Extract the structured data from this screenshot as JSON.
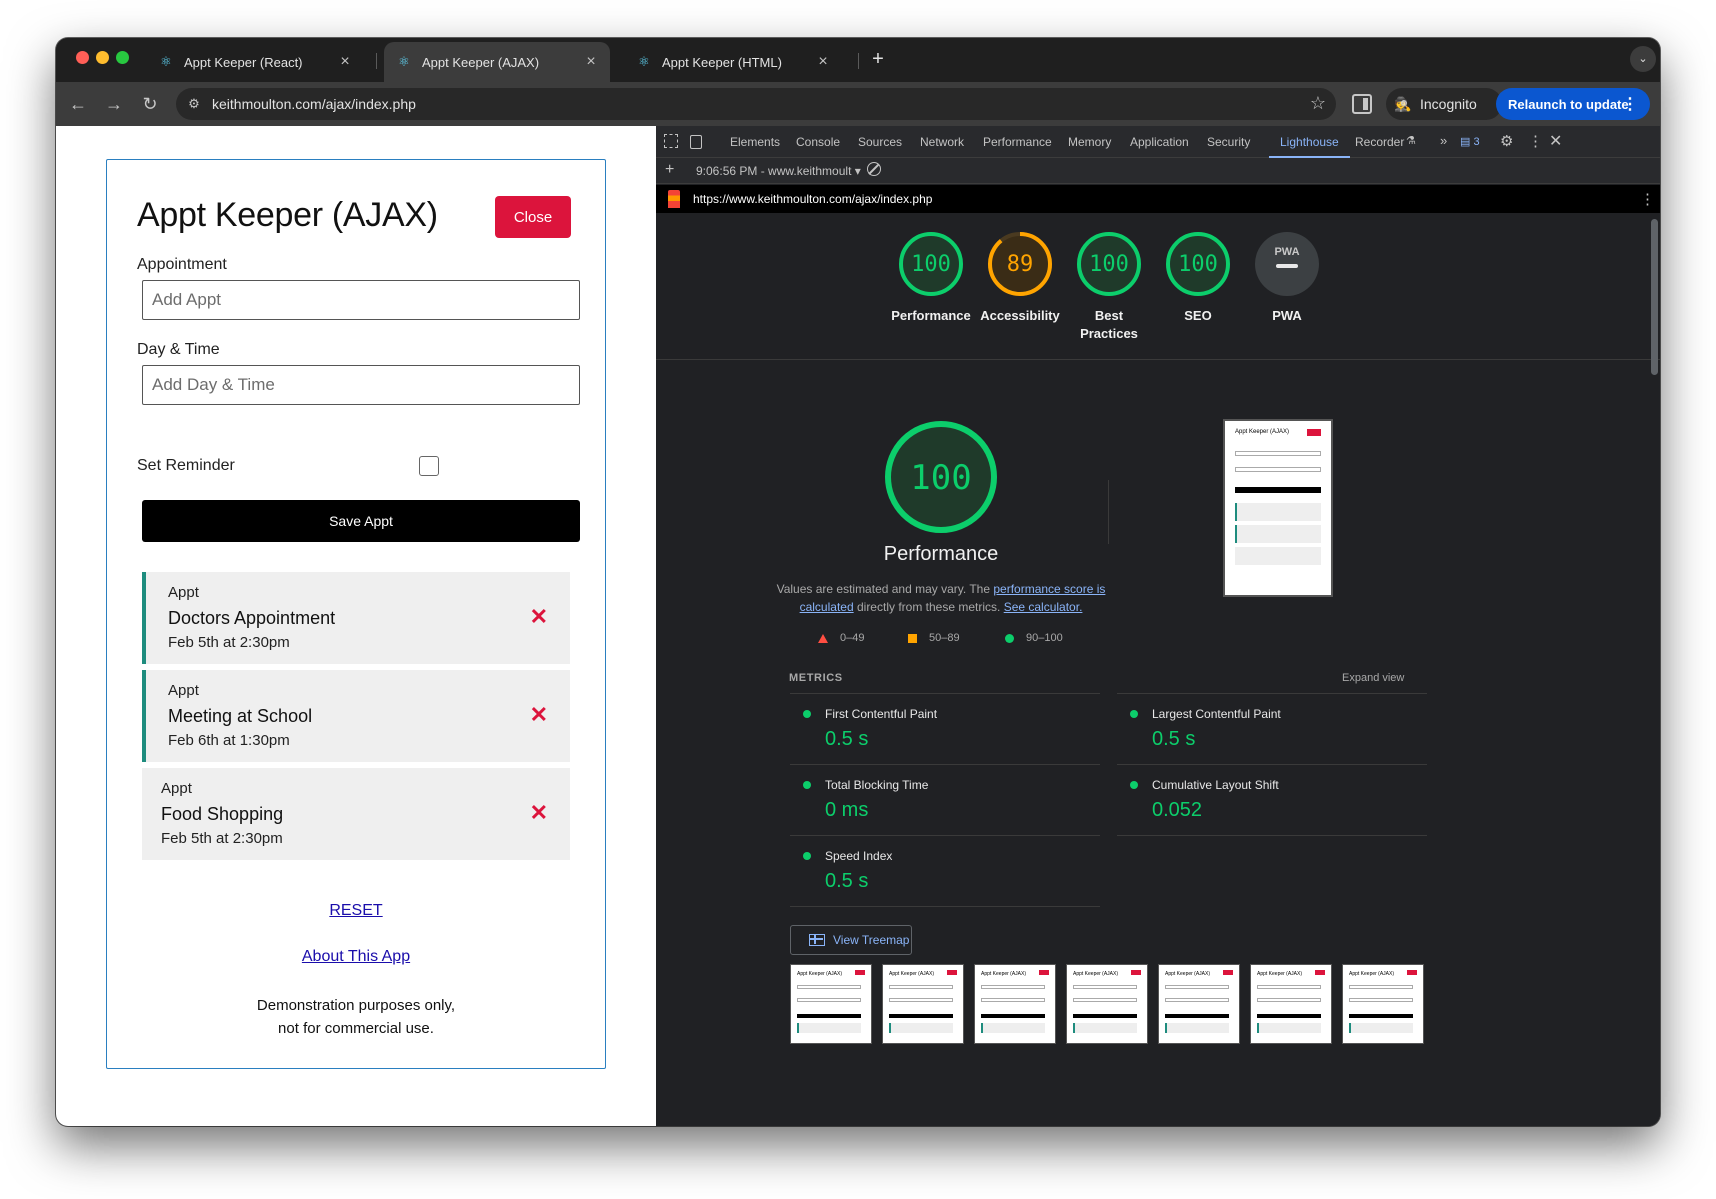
{
  "browser": {
    "tabs": [
      {
        "title": "Appt Keeper (React)",
        "active": false
      },
      {
        "title": "Appt Keeper (AJAX)",
        "active": true
      },
      {
        "title": "Appt Keeper (HTML)",
        "active": false
      }
    ],
    "url": "keithmoulton.com/ajax/index.php",
    "incognito_label": "Incognito",
    "relaunch_label": "Relaunch to update"
  },
  "page": {
    "title": "Appt Keeper (AJAX)",
    "close_label": "Close",
    "appointment_label": "Appointment",
    "appointment_placeholder": "Add Appt",
    "daytime_label": "Day & Time",
    "daytime_placeholder": "Add Day & Time",
    "reminder_label": "Set Reminder",
    "reminder_checked": false,
    "save_label": "Save Appt",
    "appointments": [
      {
        "kind": "Appt",
        "title": "Doctors Appointment",
        "when": "Feb 5th at 2:30pm",
        "reminder": true
      },
      {
        "kind": "Appt",
        "title": "Meeting at School",
        "when": "Feb 6th at 1:30pm",
        "reminder": true
      },
      {
        "kind": "Appt",
        "title": "Food Shopping",
        "when": "Feb 5th at 2:30pm",
        "reminder": false
      }
    ],
    "reset_label": "RESET",
    "about_label": "About This App",
    "footer_line1": "Demonstration purposes only,",
    "footer_line2": "not for commercial use."
  },
  "devtools": {
    "tabs": [
      "Elements",
      "Console",
      "Sources",
      "Network",
      "Performance",
      "Memory",
      "Application",
      "Security",
      "Lighthouse",
      "Recorder"
    ],
    "active_tab": "Lighthouse",
    "issues_count": "3",
    "report_time": "9:06:56 PM - www.keithmoult",
    "report_url": "https://www.keithmoulton.com/ajax/index.php",
    "scores": [
      {
        "value": "100",
        "label": "Performance",
        "status": "pass"
      },
      {
        "value": "89",
        "label": "Accessibility",
        "status": "average"
      },
      {
        "value": "100",
        "label": "Best",
        "label2": "Practices",
        "status": "pass"
      },
      {
        "value": "100",
        "label": "SEO",
        "status": "pass"
      },
      {
        "value": "PWA",
        "label": "PWA",
        "status": "na"
      }
    ],
    "performance": {
      "score": "100",
      "title": "Performance",
      "desc_1": "Values are estimated and may vary. The ",
      "desc_link": "performance score is calculated",
      "desc_2": " directly from these metrics. ",
      "desc_link2": "See calculator.",
      "legend": [
        "0–49",
        "50–89",
        "90–100"
      ]
    },
    "metrics_heading": "METRICS",
    "expand_label": "Expand view",
    "metrics": [
      {
        "name": "First Contentful Paint",
        "value": "0.5 s"
      },
      {
        "name": "Largest Contentful Paint",
        "value": "0.5 s"
      },
      {
        "name": "Total Blocking Time",
        "value": "0 ms"
      },
      {
        "name": "Cumulative Layout Shift",
        "value": "0.052"
      },
      {
        "name": "Speed Index",
        "value": "0.5 s"
      }
    ],
    "treemap_label": "View Treemap"
  },
  "colors": {
    "pass": "#0cce6b",
    "average": "#ffa400",
    "fail": "#ff4e42",
    "accent": "#8ab4f8",
    "close_red": "#dc143c",
    "relaunch": "#0b57d0"
  }
}
